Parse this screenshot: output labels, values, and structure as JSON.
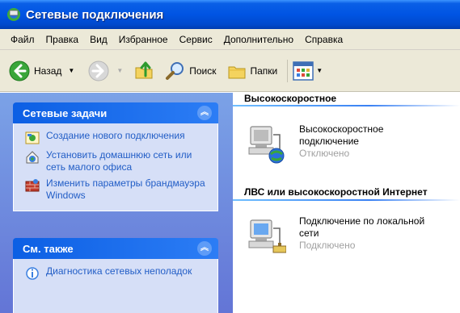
{
  "window": {
    "title": "Сетевые подключения",
    "title_icon": "network-connections-icon"
  },
  "menu": {
    "items": [
      "Файл",
      "Правка",
      "Вид",
      "Избранное",
      "Сервис",
      "Дополнительно",
      "Справка"
    ]
  },
  "toolbar": {
    "back_label": "Назад",
    "search_label": "Поиск",
    "folders_label": "Папки"
  },
  "network_tasks": {
    "title": "Сетевые задачи",
    "items": [
      {
        "label": "Создание нового подключения",
        "icon": "new-connection-icon"
      },
      {
        "label": "Установить домашнюю сеть или сеть малого офиса",
        "icon": "home-network-icon"
      },
      {
        "label": "Изменить параметры брандмауэра Windows",
        "icon": "firewall-icon"
      }
    ]
  },
  "see_also": {
    "title": "См. также",
    "items": [
      {
        "label": "Диагностика сетевых неполадок",
        "icon": "diagnostics-icon"
      }
    ]
  },
  "groups": [
    {
      "title": "Высокоскоростное",
      "connections": [
        {
          "name": "Высокоскоростное подключение",
          "status": "Отключено",
          "icon": "broadband-connection-icon"
        }
      ]
    },
    {
      "title": "ЛВС или высокоскоростной Интернет",
      "connections": [
        {
          "name": "Подключение по локальной сети",
          "status": "Подключено",
          "icon": "lan-connection-icon"
        }
      ]
    }
  ],
  "colors": {
    "titlebar": "#0054e3",
    "link": "#215dc6",
    "status_text": "#a0a0a0",
    "taskpane_bg": "#6b8ee0"
  }
}
